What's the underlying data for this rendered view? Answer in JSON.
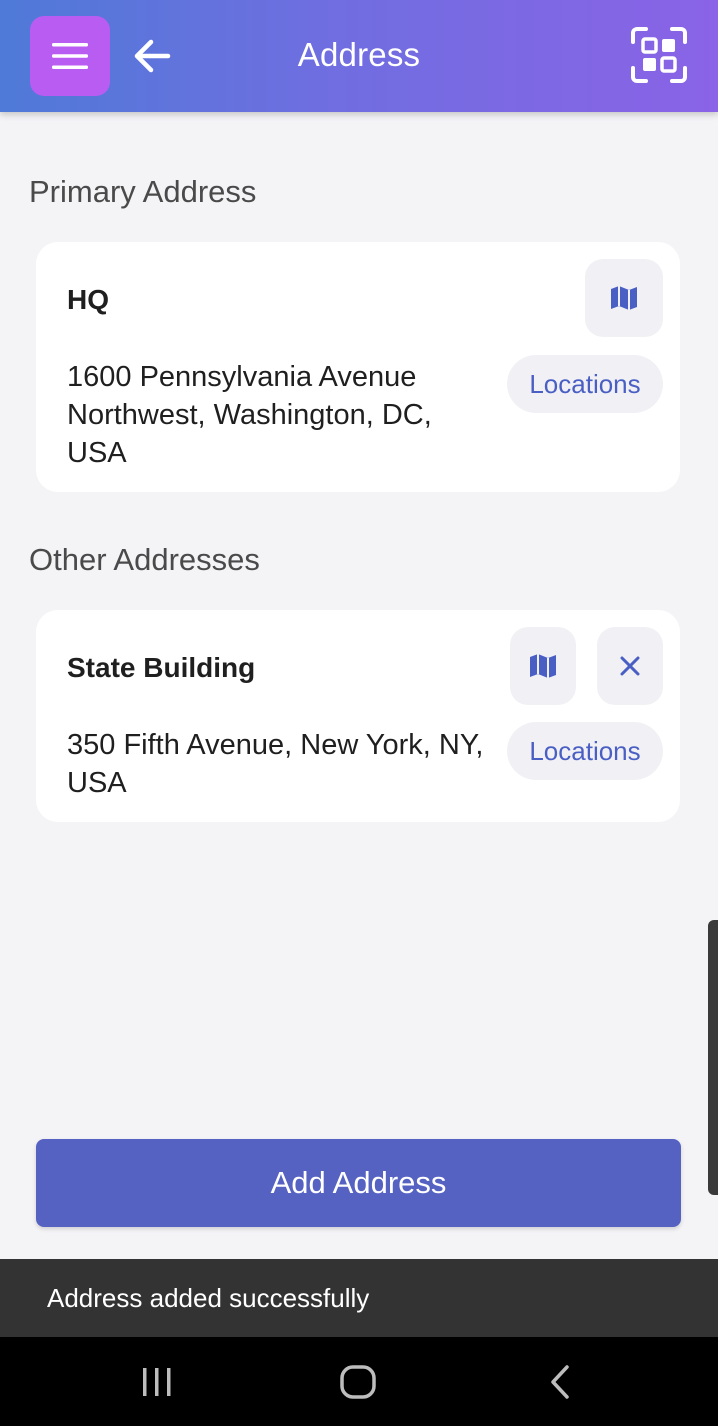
{
  "header": {
    "title": "Address",
    "gradient_start": "#4f7ad8",
    "gradient_end": "#8a63e6",
    "menu_button_color": "#b85cf2",
    "icons": [
      "menu-icon",
      "arrow-left-icon",
      "qr-scan-icon"
    ]
  },
  "primary": {
    "section_title": "Primary Address",
    "name": "HQ",
    "address": "1600 Pennsylvania Avenue Northwest, Washington, DC, USA",
    "locations_label": "Locations",
    "icons": [
      "map-icon"
    ]
  },
  "others": {
    "section_title": "Other Addresses",
    "items": [
      {
        "name": "State Building",
        "address": "350 Fifth Avenue, New York, NY, USA",
        "locations_label": "Locations",
        "icons": [
          "map-icon",
          "close-icon"
        ]
      }
    ]
  },
  "actions": {
    "add_label": "Add Address",
    "add_color": "#5662c2"
  },
  "snackbar": {
    "message": "Address added successfully"
  },
  "system_nav": {
    "icons": [
      "recent-apps-icon",
      "home-icon",
      "back-chevron-icon"
    ]
  },
  "colors": {
    "accent_text": "#4a5fc4",
    "background": "#f4f4f7"
  }
}
